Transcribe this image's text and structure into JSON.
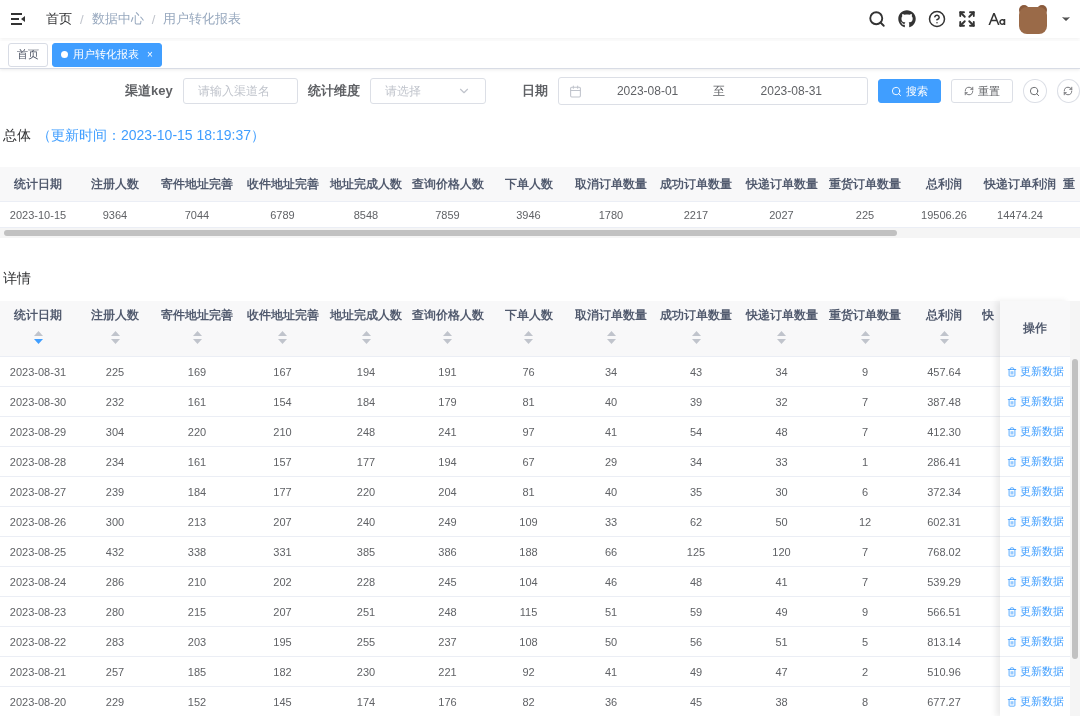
{
  "topbar": {
    "breadcrumb": [
      {
        "label": "首页"
      },
      {
        "separator": "/",
        "label": "数据中心"
      },
      {
        "separator": "/",
        "label": "用户转化报表"
      }
    ]
  },
  "tabs": [
    {
      "label": "首页",
      "selected": false
    },
    {
      "label": "用户转化报表",
      "selected": true,
      "close_label": "×"
    }
  ],
  "filters": {
    "channel": {
      "label": "渠道key",
      "placeholder": "请输入渠道名"
    },
    "dimension": {
      "label": "统计维度",
      "placeholder": "请选择"
    },
    "date": {
      "label": "日期",
      "start": "2023-08-01",
      "separator": "至",
      "end": "2023-08-31"
    },
    "search_button": "搜索",
    "reset_button": "重置"
  },
  "summary": {
    "title": "总体",
    "updated": "（更新时间：2023-10-15 18:19:37）",
    "columns": [
      "统计日期",
      "注册人数",
      "寄件地址完善",
      "收件地址完善",
      "地址完成人数",
      "查询价格人数",
      "下单人数",
      "取消订单数量",
      "成功订单数量",
      "快递订单数量",
      "重货订单数量",
      "总利润",
      "快递订单利润",
      "重"
    ],
    "row": [
      "2023-10-15",
      "9364",
      "7044",
      "6789",
      "8548",
      "7859",
      "3946",
      "1780",
      "2217",
      "2027",
      "225",
      "19506.26",
      "14474.24"
    ]
  },
  "details": {
    "title": "详情",
    "columns": [
      {
        "label": "统计日期",
        "sortable": true,
        "sorted": true
      },
      {
        "label": "注册人数",
        "sortable": true,
        "sorted": false
      },
      {
        "label": "寄件地址完善",
        "sortable": true,
        "sorted": false
      },
      {
        "label": "收件地址完善",
        "sortable": true,
        "sorted": false
      },
      {
        "label": "地址完成人数",
        "sortable": true,
        "sorted": false
      },
      {
        "label": "查询价格人数",
        "sortable": true,
        "sorted": false
      },
      {
        "label": "下单人数",
        "sortable": true,
        "sorted": false
      },
      {
        "label": "取消订单数量",
        "sortable": true,
        "sorted": false
      },
      {
        "label": "成功订单数量",
        "sortable": true,
        "sorted": false
      },
      {
        "label": "快递订单数量",
        "sortable": true,
        "sorted": false
      },
      {
        "label": "重货订单数量",
        "sortable": true,
        "sorted": false
      },
      {
        "label": "总利润",
        "sortable": true,
        "sorted": false
      },
      {
        "label": "快",
        "sortable": false
      }
    ],
    "action_header": "操作",
    "rows": [
      {
        "cells": [
          "2023-08-31",
          "225",
          "169",
          "167",
          "194",
          "191",
          "76",
          "34",
          "43",
          "34",
          "9",
          "457.64"
        ],
        "action": "更新数据"
      },
      {
        "cells": [
          "2023-08-30",
          "232",
          "161",
          "154",
          "184",
          "179",
          "81",
          "40",
          "39",
          "32",
          "7",
          "387.48"
        ],
        "action": "更新数据"
      },
      {
        "cells": [
          "2023-08-29",
          "304",
          "220",
          "210",
          "248",
          "241",
          "97",
          "41",
          "54",
          "48",
          "7",
          "412.30"
        ],
        "action": "更新数据"
      },
      {
        "cells": [
          "2023-08-28",
          "234",
          "161",
          "157",
          "177",
          "194",
          "67",
          "29",
          "34",
          "33",
          "1",
          "286.41"
        ],
        "action": "更新数据"
      },
      {
        "cells": [
          "2023-08-27",
          "239",
          "184",
          "177",
          "220",
          "204",
          "81",
          "40",
          "35",
          "30",
          "6",
          "372.34"
        ],
        "action": "更新数据"
      },
      {
        "cells": [
          "2023-08-26",
          "300",
          "213",
          "207",
          "240",
          "249",
          "109",
          "33",
          "62",
          "50",
          "12",
          "602.31"
        ],
        "action": "更新数据"
      },
      {
        "cells": [
          "2023-08-25",
          "432",
          "338",
          "331",
          "385",
          "386",
          "188",
          "66",
          "125",
          "120",
          "7",
          "768.02"
        ],
        "action": "更新数据"
      },
      {
        "cells": [
          "2023-08-24",
          "286",
          "210",
          "202",
          "228",
          "245",
          "104",
          "46",
          "48",
          "41",
          "7",
          "539.29"
        ],
        "action": "更新数据"
      },
      {
        "cells": [
          "2023-08-23",
          "280",
          "215",
          "207",
          "251",
          "248",
          "115",
          "51",
          "59",
          "49",
          "9",
          "566.51"
        ],
        "action": "更新数据"
      },
      {
        "cells": [
          "2023-08-22",
          "283",
          "203",
          "195",
          "255",
          "237",
          "108",
          "50",
          "56",
          "51",
          "5",
          "813.14"
        ],
        "action": "更新数据"
      },
      {
        "cells": [
          "2023-08-21",
          "257",
          "185",
          "182",
          "230",
          "221",
          "92",
          "41",
          "49",
          "47",
          "2",
          "510.96"
        ],
        "action": "更新数据"
      },
      {
        "cells": [
          "2023-08-20",
          "229",
          "152",
          "145",
          "174",
          "176",
          "82",
          "36",
          "45",
          "38",
          "8",
          "677.27"
        ],
        "action": "更新数据"
      }
    ]
  }
}
